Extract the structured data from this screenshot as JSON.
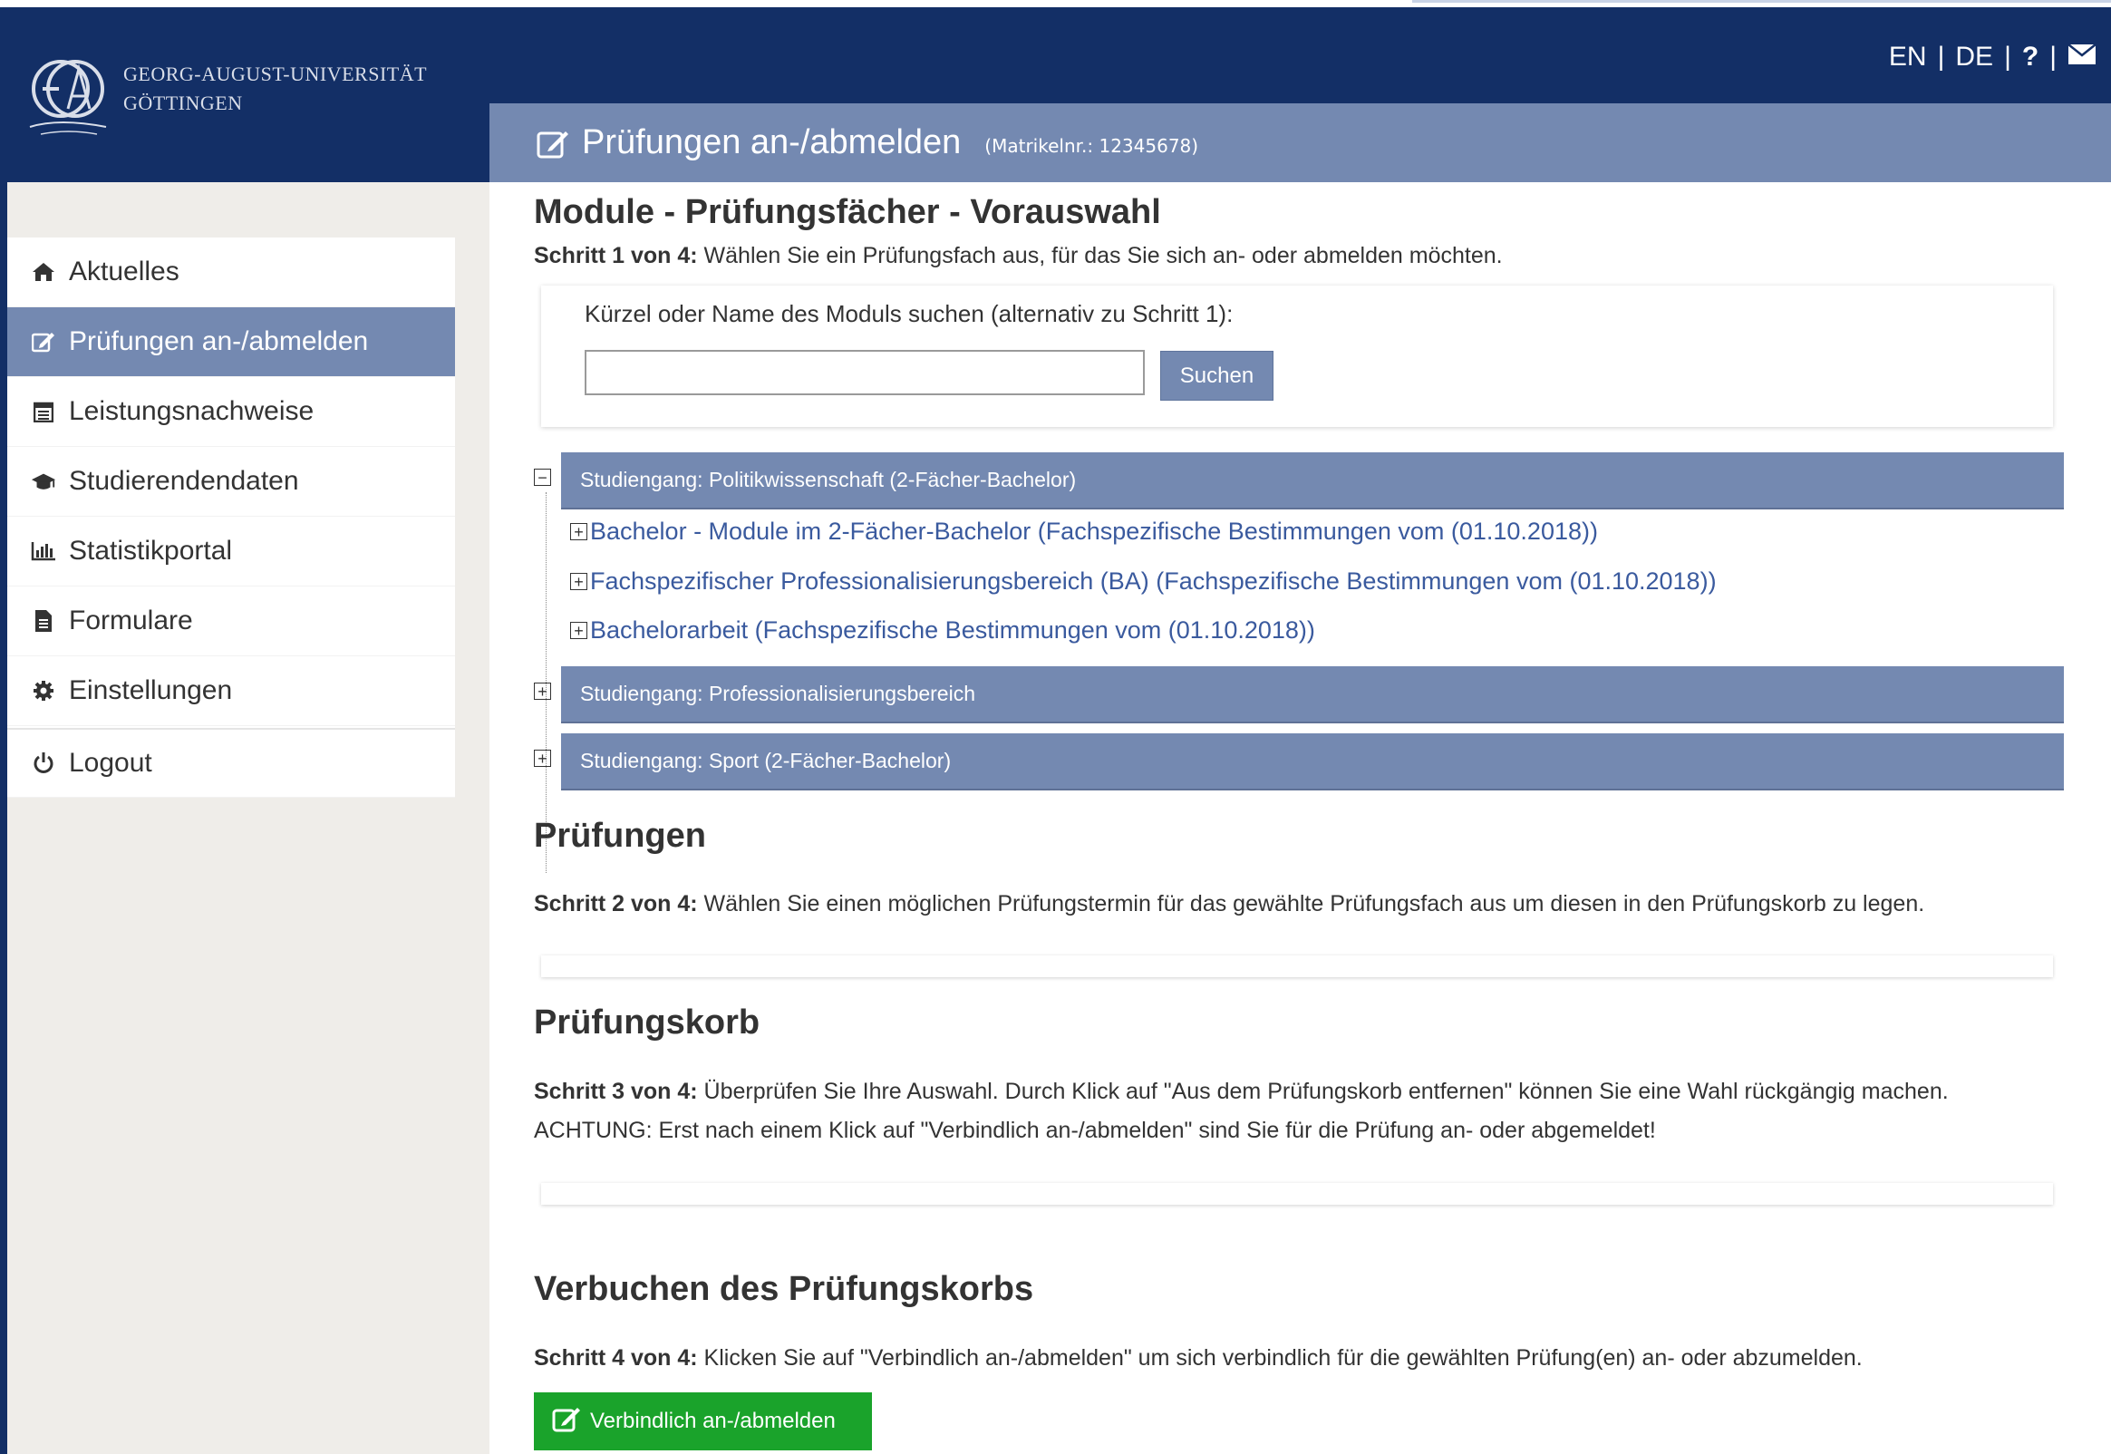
{
  "header": {
    "university_line1": "GEORG-AUGUST-UNIVERSITÄT",
    "university_line2": "GÖTTINGEN",
    "lang_en": "EN",
    "lang_de": "DE",
    "separator": "|",
    "help": "?",
    "page_title": "Prüfungen an-/abmelden",
    "matrikel": "(Matrikelnr.: 12345678)"
  },
  "sidebar": {
    "items": [
      {
        "label": "Aktuelles",
        "icon": "home-icon"
      },
      {
        "label": "Prüfungen an-/abmelden",
        "icon": "edit-icon",
        "active": true
      },
      {
        "label": "Leistungsnachweise",
        "icon": "calendar-icon"
      },
      {
        "label": "Studierendendaten",
        "icon": "graduation-cap-icon"
      },
      {
        "label": "Statistikportal",
        "icon": "bar-chart-icon"
      },
      {
        "label": "Formulare",
        "icon": "file-icon"
      },
      {
        "label": "Einstellungen",
        "icon": "gear-icon"
      }
    ],
    "logout": "Logout"
  },
  "section1": {
    "heading": "Module - Prüfungsfächer - Vorauswahl",
    "step_bold": "Schritt 1 von 4:",
    "step_text": " Wählen Sie ein Prüfungsfach aus, für das Sie sich an- oder abmelden möchten.",
    "search_label": "Kürzel oder Name des Moduls suchen (alternativ zu Schritt 1):",
    "search_value": "",
    "search_button": "Suchen"
  },
  "tree": {
    "groups": [
      {
        "label": "Studiengang: Politikwissenschaft (2-Fächer-Bachelor)",
        "expanded": true,
        "children": [
          "Bachelor - Module im 2-Fächer-Bachelor (Fachspezifische Bestimmungen vom (01.10.2018))",
          "Fachspezifischer Professionalisierungsbereich (BA) (Fachspezifische Bestimmungen vom (01.10.2018))",
          "Bachelorarbeit (Fachspezifische Bestimmungen vom (01.10.2018))"
        ]
      },
      {
        "label": "Studiengang: Professionalisierungsbereich",
        "expanded": false
      },
      {
        "label": "Studiengang: Sport (2-Fächer-Bachelor)",
        "expanded": false
      }
    ]
  },
  "section2": {
    "heading": "Prüfungen",
    "step_bold": "Schritt 2 von 4:",
    "step_text": " Wählen Sie einen möglichen Prüfungstermin für das gewählte Prüfungsfach aus um diesen in den Prüfungskorb zu legen."
  },
  "section3": {
    "heading": "Prüfungskorb",
    "step_bold": "Schritt 3 von 4:",
    "step_text": " Überprüfen Sie Ihre Auswahl. Durch Klick auf \"Aus dem Prüfungskorb entfernen\" können Sie eine Wahl rückgängig machen.",
    "warning": "ACHTUNG: Erst nach einem Klick auf \"Verbindlich an-/abmelden\" sind Sie für die Prüfung an- oder abgemeldet!"
  },
  "section4": {
    "heading": "Verbuchen des Prüfungskorbs",
    "step_bold": "Schritt 4 von 4:",
    "step_text": " Klicken Sie auf \"Verbindlich an-/abmelden\" um sich verbindlich für die gewählten Prüfung(en) an- oder abzumelden.",
    "button": "Verbindlich an-/abmelden"
  },
  "colors": {
    "navy": "#132f66",
    "accent": "#7489b1",
    "link": "#3a5a9e",
    "submit": "#1aa32b"
  }
}
